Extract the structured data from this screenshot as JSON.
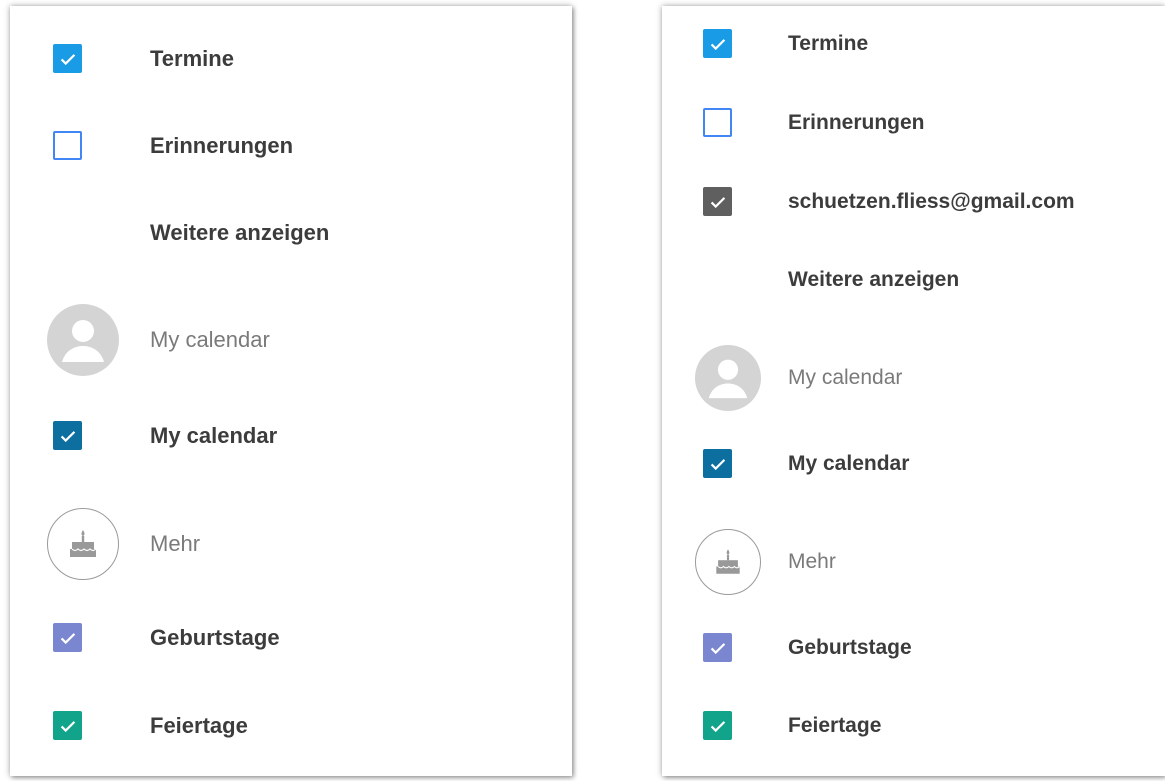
{
  "colors": {
    "termine": "#1a9be6",
    "erinnerungen_border": "#4285f4",
    "account": "#5f5f5f",
    "my_calendar": "#0d6fa0",
    "geburtstage": "#7b86d1",
    "feiertage": "#12a38b"
  },
  "left": {
    "termine": "Termine",
    "erinnerungen": "Erinnerungen",
    "weitere": "Weitere anzeigen",
    "my_calendar_header": "My calendar",
    "my_calendar": "My calendar",
    "mehr": "Mehr",
    "geburtstage": "Geburtstage",
    "feiertage": "Feiertage"
  },
  "right": {
    "termine": "Termine",
    "erinnerungen": "Erinnerungen",
    "account": "schuetzen.fliess@gmail.com",
    "weitere": "Weitere anzeigen",
    "my_calendar_header": "My calendar",
    "my_calendar": "My calendar",
    "mehr": "Mehr",
    "geburtstage": "Geburtstage",
    "feiertage": "Feiertage"
  }
}
